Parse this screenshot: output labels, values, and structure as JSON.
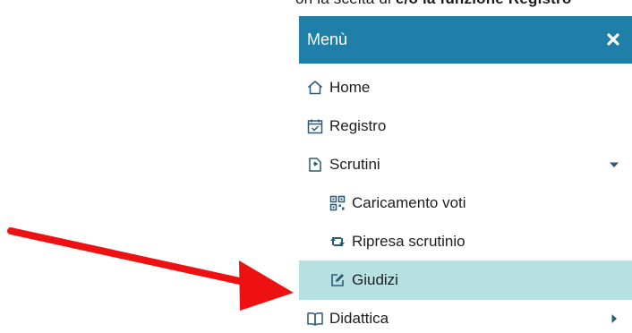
{
  "page": {
    "top_text_partial": "on la scelta di ",
    "top_text_bold": "e/o la funzione Registro"
  },
  "menu": {
    "title": "Menù",
    "close_icon": "close-icon",
    "header_color": "#1f7fa8",
    "active_color": "#b7e1e1",
    "items": [
      {
        "label": "Home",
        "icon": "home-icon",
        "level": 1
      },
      {
        "label": "Registro",
        "icon": "calendar-check-icon",
        "level": 1
      },
      {
        "label": "Scrutini",
        "icon": "scrutini-icon",
        "level": 1,
        "expanded": true
      },
      {
        "label": "Caricamento voti",
        "icon": "qr-code-icon",
        "level": 2
      },
      {
        "label": "Ripresa scrutinio",
        "icon": "retweet-icon",
        "level": 2
      },
      {
        "label": "Giudizi",
        "icon": "edit-icon",
        "level": 2,
        "active": true
      },
      {
        "label": "Didattica",
        "icon": "book-open-icon",
        "level": 1,
        "expanded": false
      }
    ]
  },
  "annotation": {
    "arrow_color": "#ee1111",
    "points_to": "Giudizi"
  }
}
